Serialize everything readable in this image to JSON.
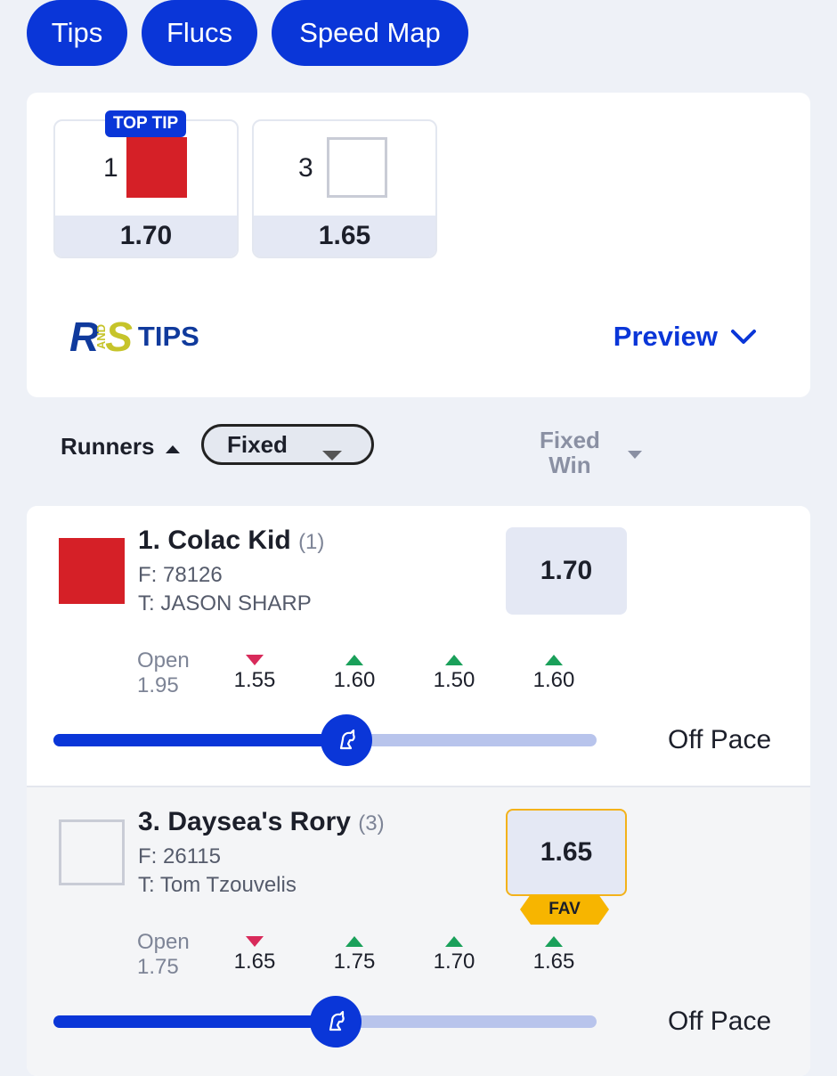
{
  "nav": {
    "tabs": [
      {
        "label": "Tips"
      },
      {
        "label": "Flucs"
      },
      {
        "label": "Speed Map"
      }
    ]
  },
  "tips_card": {
    "top_tip_label": "TOP TIP",
    "tips": [
      {
        "number": "1",
        "odds": "1.70",
        "silk_color": "#d52027"
      },
      {
        "number": "3",
        "odds": "1.65",
        "silk_color": "#ffffff"
      }
    ],
    "logo": {
      "r": "R",
      "and": "AND",
      "s": "S",
      "tips": "TIPS"
    },
    "preview_label": "Preview"
  },
  "sort_bar": {
    "runners_label": "Runners",
    "fixed_label": "Fixed",
    "fixed_win_line1": "Fixed",
    "fixed_win_line2": "Win"
  },
  "runners": [
    {
      "name": "1. Colac Kid",
      "barrier": "(1)",
      "form": "F: 78126",
      "trainer": "T: JASON SHARP",
      "odds": "1.70",
      "fav": false,
      "silk_color": "#d52027",
      "open_label": "Open",
      "open_value": "1.95",
      "flucs": [
        {
          "value": "1.55",
          "direction": "down"
        },
        {
          "value": "1.60",
          "direction": "up"
        },
        {
          "value": "1.50",
          "direction": "up"
        },
        {
          "value": "1.60",
          "direction": "up"
        }
      ],
      "speed_position": 0.54,
      "pace_label": "Off Pace"
    },
    {
      "name": "3. Daysea's Rory",
      "barrier": "(3)",
      "form": "F: 26115",
      "trainer": "T: Tom Tzouvelis",
      "odds": "1.65",
      "fav": true,
      "fav_label": "FAV",
      "silk_color": "#ffffff",
      "open_label": "Open",
      "open_value": "1.75",
      "flucs": [
        {
          "value": "1.65",
          "direction": "down"
        },
        {
          "value": "1.75",
          "direction": "up"
        },
        {
          "value": "1.70",
          "direction": "up"
        },
        {
          "value": "1.65",
          "direction": "up"
        }
      ],
      "speed_position": 0.52,
      "pace_label": "Off Pace"
    }
  ],
  "colors": {
    "accent": "#0a36d8",
    "up": "#1aa05a",
    "down": "#d82a5a",
    "fav": "#f7b500"
  }
}
